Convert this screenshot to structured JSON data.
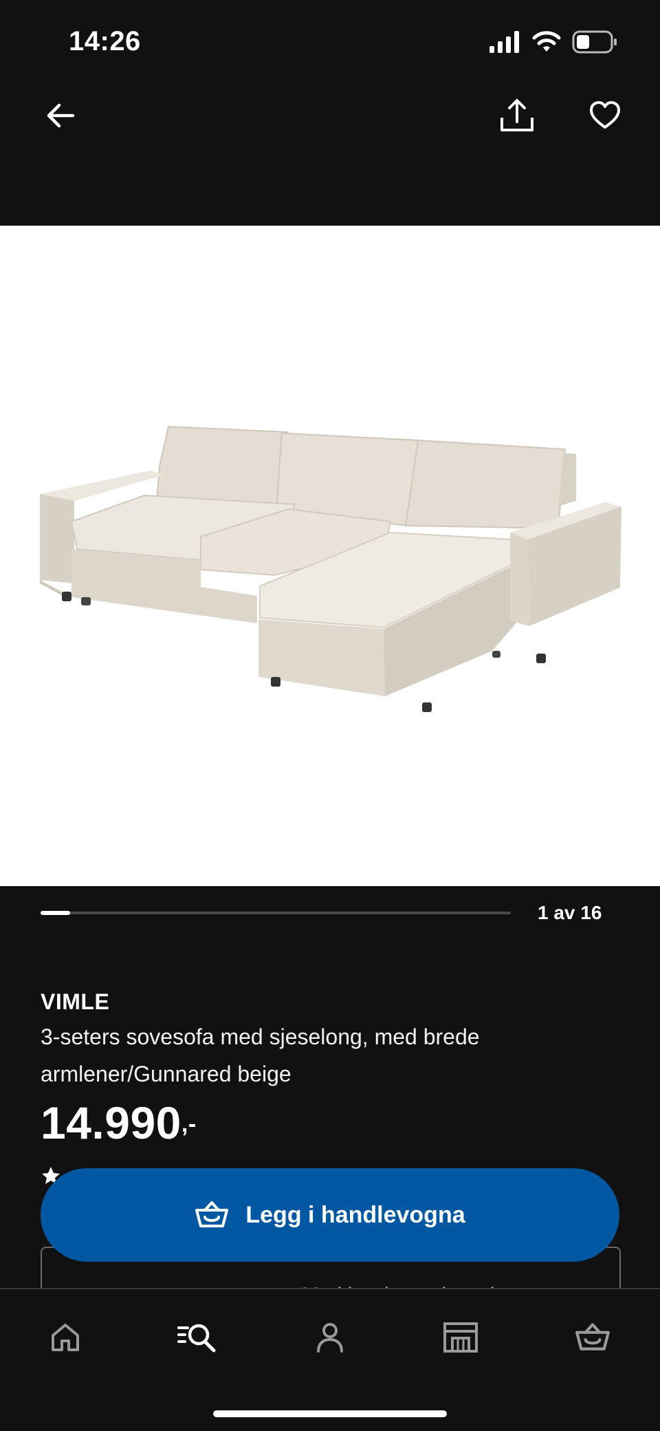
{
  "status_bar": {
    "time": "14:26"
  },
  "gallery": {
    "counter": "1 av 16",
    "progress_fraction": 0.0625
  },
  "product": {
    "brand": "VIMLE",
    "description_line1": "3-seters sovesofa med sjeselong, med brede",
    "description_line2": "armlener/Gunnared beige",
    "price": "14.990",
    "price_suffix": ",-"
  },
  "cart_button": {
    "label": "Legg i handlevogna"
  },
  "variant": {
    "text": "Med brede armlener/"
  },
  "icons": {
    "back": "arrow-left-icon",
    "share": "share-icon",
    "favorite": "heart-icon",
    "cart": "basket-icon",
    "nav": [
      "home-icon",
      "search-icon",
      "profile-icon",
      "store-icon",
      "basket-icon"
    ]
  },
  "colors": {
    "accent": "#0058a3",
    "background": "#111111"
  }
}
